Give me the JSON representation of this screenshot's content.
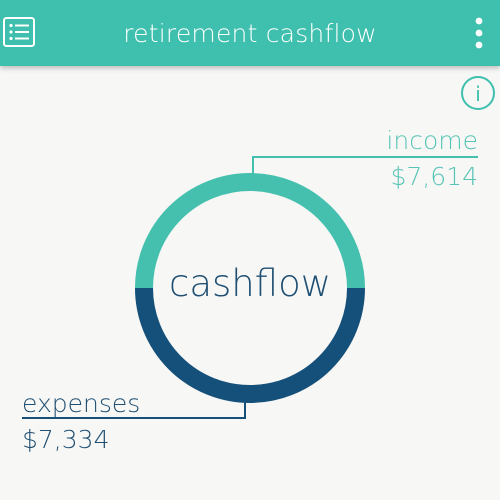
{
  "header": {
    "title": "retirement cashflow",
    "menu_icon": "list-menu-icon",
    "more_icon": "more-vertical-icon",
    "background_color": "#3fbfad"
  },
  "info": {
    "icon": "info-circle-icon",
    "label": "i"
  },
  "cashflow": {
    "center_label": "cashflow",
    "income": {
      "label": "income",
      "value": "$7,614",
      "amount": 7614,
      "color": "#45c0ae"
    },
    "expenses": {
      "label": "expenses",
      "value": "$7,334",
      "amount": 7334,
      "color": "#15507a"
    }
  },
  "colors": {
    "background": "#f7f7f6",
    "income_text": "#58c4b6",
    "expenses_text": "#1f4f72"
  }
}
